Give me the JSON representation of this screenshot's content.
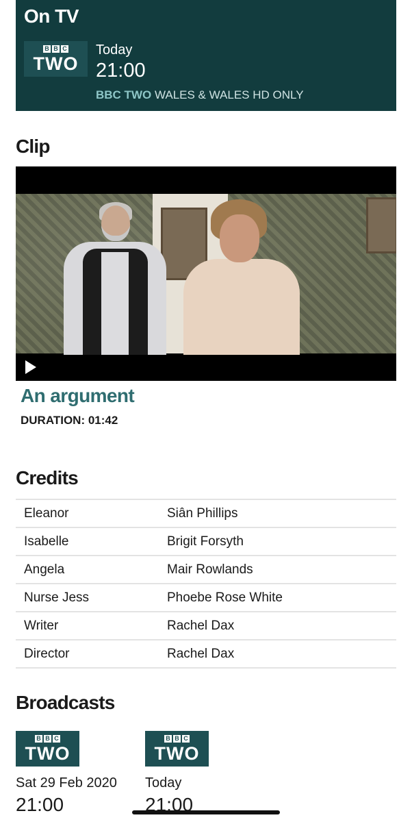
{
  "on_tv": {
    "heading": "On TV",
    "logo": {
      "top": "BBC",
      "bottom": "TWO",
      "blocks": [
        "B",
        "B",
        "C"
      ]
    },
    "day": "Today",
    "time": "21:00",
    "channel_name": "BBC TWO",
    "channel_region": "WALES & WALES HD ONLY"
  },
  "clip": {
    "heading": "Clip",
    "title": "An argument",
    "duration": "DURATION: 01:42",
    "play_icon": "play-icon"
  },
  "credits": {
    "heading": "Credits",
    "rows": [
      {
        "role": "Eleanor",
        "name": "Siân Phillips"
      },
      {
        "role": "Isabelle",
        "name": "Brigit Forsyth"
      },
      {
        "role": "Angela",
        "name": "Mair Rowlands"
      },
      {
        "role": "Nurse Jess",
        "name": "Phoebe Rose White"
      },
      {
        "role": "Writer",
        "name": "Rachel Dax"
      },
      {
        "role": "Director",
        "name": "Rachel Dax"
      }
    ]
  },
  "broadcasts": {
    "heading": "Broadcasts",
    "items": [
      {
        "logo_bottom": "TWO",
        "date": "Sat 29 Feb 2020",
        "time": "21:00"
      },
      {
        "logo_bottom": "TWO",
        "date": "Today",
        "time": "21:00"
      }
    ]
  },
  "colors": {
    "on_tv_background": "#123c3e",
    "logo_background": "#1e4f53",
    "accent": "#2f6d70",
    "channel_highlight": "#8ec6c7"
  }
}
